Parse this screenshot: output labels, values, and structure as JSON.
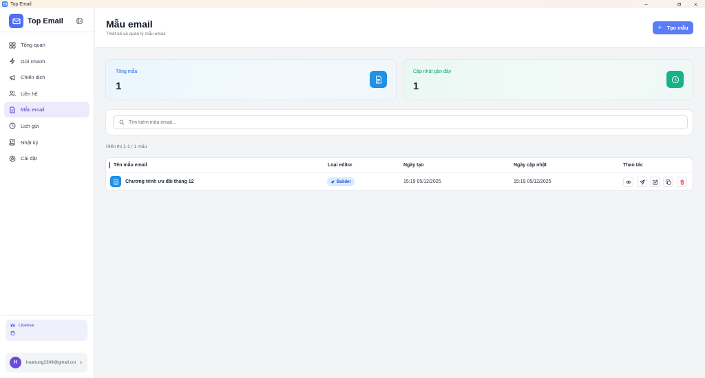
{
  "window": {
    "title": "Top Email"
  },
  "sidebar": {
    "brand": "Top Email",
    "items": [
      {
        "label": "Tổng quan",
        "icon": "dashboard-icon"
      },
      {
        "label": "Gửi nhanh",
        "icon": "zap-icon"
      },
      {
        "label": "Chiến dịch",
        "icon": "megaphone-icon"
      },
      {
        "label": "Liên hệ",
        "icon": "users-icon"
      },
      {
        "label": "Mẫu email",
        "icon": "file-icon",
        "active": true
      },
      {
        "label": "Lịch gửi",
        "icon": "clock-icon"
      },
      {
        "label": "Nhật ký",
        "icon": "scroll-icon"
      },
      {
        "label": "Cài đặt",
        "icon": "settings-icon"
      }
    ],
    "license": {
      "label": "License"
    },
    "user": {
      "initial": "H",
      "email": "hoahung2309@gmail.com"
    }
  },
  "header": {
    "title": "Mẫu email",
    "subtitle": "Thiết kế và quản lý mẫu email",
    "create_label": "Tạo mẫu"
  },
  "stats": [
    {
      "label": "Tổng mẫu",
      "value": "1",
      "icon": "document-icon",
      "color": "#1e90e6"
    },
    {
      "label": "Cập nhật gần đây",
      "value": "1",
      "icon": "clock-icon",
      "color": "#14b38a"
    }
  ],
  "search": {
    "placeholder": "Tìm kiếm mẫu email...",
    "value": ""
  },
  "showing": "Hiển thị 1-1 / 1 mẫu",
  "table": {
    "columns": [
      "Tên mẫu email",
      "Loại editor",
      "Ngày tạo",
      "Ngày cập nhật",
      "Thao tác"
    ],
    "rows": [
      {
        "name": "Chương trình ưu đãi tháng 12",
        "editor": "Builder",
        "created": "15:19 05/12/2025",
        "updated": "15:19 05/12/2025",
        "actions": [
          "eye-icon",
          "send-icon",
          "edit-icon",
          "copy-icon",
          "trash-icon"
        ]
      }
    ]
  },
  "colors": {
    "accent": "#5b7cf7",
    "active_bg": "#eeeafb",
    "danger": "#dc2626"
  }
}
